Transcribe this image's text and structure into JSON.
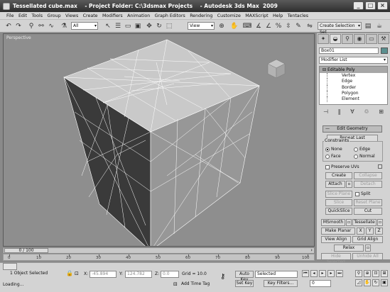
{
  "window": {
    "title": "Tessellated cube.max    - Project Folder: C:\\3dsmax Projects    - Autodesk 3ds Max  2009"
  },
  "menu": [
    "File",
    "Edit",
    "Tools",
    "Group",
    "Views",
    "Create",
    "Modifiers",
    "Animation",
    "Graph Editors",
    "Rendering",
    "Customize",
    "MAXScript",
    "Help",
    "Tentacles"
  ],
  "toolbar": {
    "selection_filter": "All",
    "ref_coord": "View",
    "named_selection": "Create Selection Set"
  },
  "viewport": {
    "label": "Perspective"
  },
  "command_panel": {
    "object_name": "Box01",
    "object_color": "#5a8f8f",
    "modifier_list": "Modifier List",
    "stack_top": "Editable Poly",
    "stack_subs": [
      "Vertex",
      "Edge",
      "Border",
      "Polygon",
      "Element"
    ],
    "rollout_title": "Edit Geometry",
    "repeat_last": "Repeat Last",
    "constraints_label": "Constraints",
    "constraints": {
      "none": "None",
      "edge": "Edge",
      "face": "Face",
      "normal": "Normal"
    },
    "preserve_uvs": "Preserve UVs",
    "create": "Create",
    "collapse": "Collapse",
    "attach": "Attach",
    "detach": "Detach",
    "slice_plane": "Slice Plane",
    "split": "Split",
    "slice": "Slice",
    "reset_plane": "Reset Plane",
    "quickslice": "QuickSlice",
    "cut": "Cut",
    "msmooth": "MSmooth",
    "tessellate": "Tessellate",
    "make_planar": "Make Planar",
    "x": "X",
    "y": "Y",
    "z": "Z",
    "view_align": "View Align",
    "grid_align": "Grid Align",
    "relax": "Relax",
    "hide_selected": "Hide Selected",
    "unhide_all": "Unhide All"
  },
  "time": {
    "slider": "0 / 100",
    "ticks": [
      "0",
      "10",
      "20",
      "30",
      "40",
      "50",
      "60",
      "70",
      "80",
      "90",
      "100"
    ]
  },
  "status": {
    "selection": "1 Object Selected",
    "prompt": "Loading...",
    "x_label": "X:",
    "x_value": "-45.894",
    "y_label": "Y:",
    "y_value": "124.782",
    "z_label": "Z:",
    "z_value": "0.0",
    "grid": "Grid = 10.0",
    "add_time_tag": "Add Time Tag",
    "auto_key": "Auto Key",
    "set_key": "Set Key",
    "key_mode": "Selected",
    "key_filters": "Key Filters...",
    "frame": "0"
  }
}
